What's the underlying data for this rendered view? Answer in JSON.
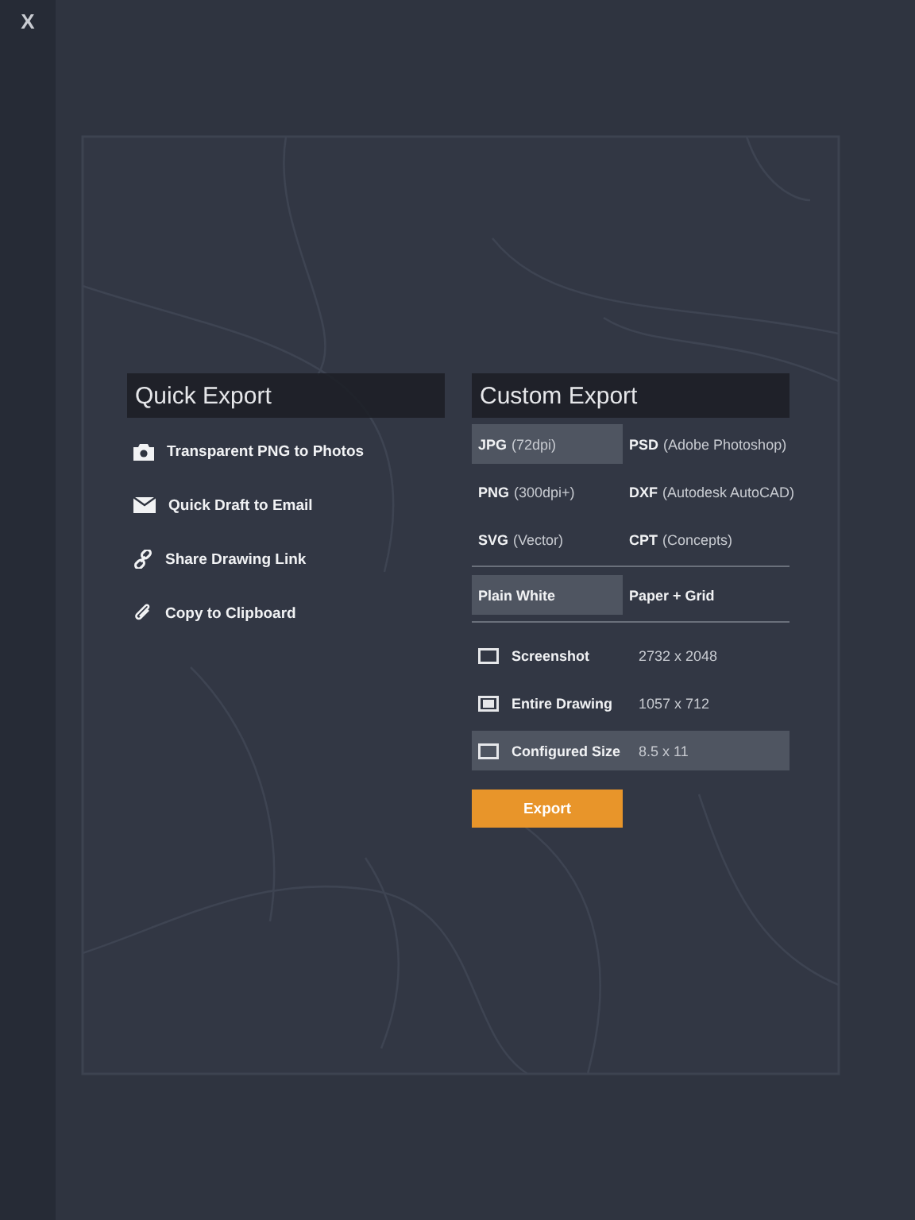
{
  "close_label": "X",
  "quick_export": {
    "title": "Quick Export",
    "items": [
      {
        "kind": "camera",
        "label": "Transparent PNG to Photos"
      },
      {
        "kind": "mail",
        "label": "Quick Draft to Email"
      },
      {
        "kind": "link",
        "label": "Share Drawing Link"
      },
      {
        "kind": "clip",
        "label": "Copy to Clipboard"
      }
    ]
  },
  "custom_export": {
    "title": "Custom Export",
    "formats": [
      {
        "format": "JPG",
        "detail": "(72dpi)",
        "selected": true
      },
      {
        "format": "PSD",
        "detail": "(Adobe Photoshop)",
        "selected": false
      },
      {
        "format": "PNG",
        "detail": "(300dpi+)",
        "selected": false
      },
      {
        "format": "DXF",
        "detail": "(Autodesk AutoCAD)",
        "selected": false
      },
      {
        "format": "SVG",
        "detail": "(Vector)",
        "selected": false
      },
      {
        "format": "CPT",
        "detail": "(Concepts)",
        "selected": false
      }
    ],
    "backgrounds": [
      {
        "label": "Plain White",
        "selected": true
      },
      {
        "label": "Paper + Grid",
        "selected": false
      }
    ],
    "sizes": [
      {
        "kind": "screen",
        "label": "Screenshot",
        "dims": "2732 x 2048",
        "selected": false
      },
      {
        "kind": "drawing",
        "label": "Entire Drawing",
        "dims": "1057 x 712",
        "selected": false
      },
      {
        "kind": "screen",
        "label": "Configured Size",
        "dims": "8.5 x 11",
        "selected": true
      }
    ],
    "button": "Export"
  }
}
